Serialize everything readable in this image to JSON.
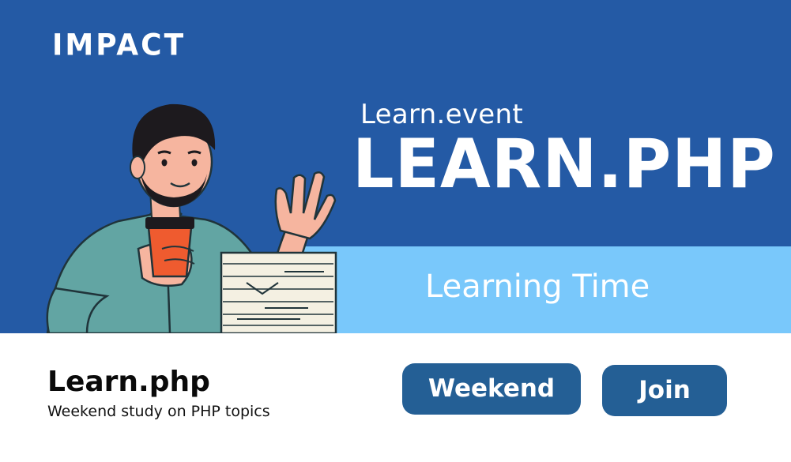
{
  "brand": {
    "logo_text": "IMPACT"
  },
  "hero": {
    "subtitle": "Learn.event",
    "headline": "LEARN.PHP",
    "ribbon_text": "Learning Time"
  },
  "event": {
    "title": "Learn.php",
    "description": "Weekend study on PHP topics"
  },
  "buttons": {
    "weekend_label": "Weekend",
    "join_label": "Join"
  },
  "colors": {
    "hero_background": "#245aa5",
    "ribbon_background": "#79c8fb",
    "button_background": "#245f95",
    "shirt": "#62a5a3",
    "cup": "#ef5b2f",
    "skin": "#f6b59f",
    "hair": "#1d1a1e",
    "paper": "#f4f0e2"
  },
  "illustration": {
    "icon": "man-with-coffee-and-papers-illustration"
  }
}
